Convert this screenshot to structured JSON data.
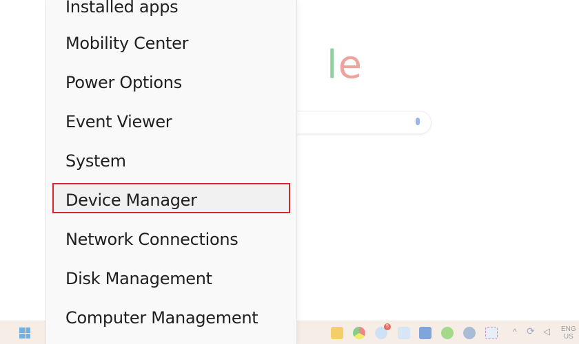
{
  "browser_background": {
    "logo_partial": {
      "l": "l",
      "e": "e"
    },
    "mic_icon": "microphone-icon"
  },
  "menu": {
    "items": [
      {
        "label": "Installed apps"
      },
      {
        "label": "Mobility Center"
      },
      {
        "label": "Power Options"
      },
      {
        "label": "Event Viewer"
      },
      {
        "label": "System"
      },
      {
        "label": "Device Manager",
        "highlighted": true
      },
      {
        "label": "Network Connections"
      },
      {
        "label": "Disk Management"
      },
      {
        "label": "Computer Management"
      }
    ],
    "highlight_color": "#d32630"
  },
  "taskbar": {
    "apps": [
      "start-icon",
      "file-explorer-icon",
      "chrome-icon",
      "zalo-icon",
      "monitor-icon",
      "word-icon",
      "app-icon",
      "settings-icon",
      "snipping-tool-icon"
    ],
    "notification_badge": "5",
    "language": {
      "line1": "ENG",
      "line2": "US"
    }
  }
}
